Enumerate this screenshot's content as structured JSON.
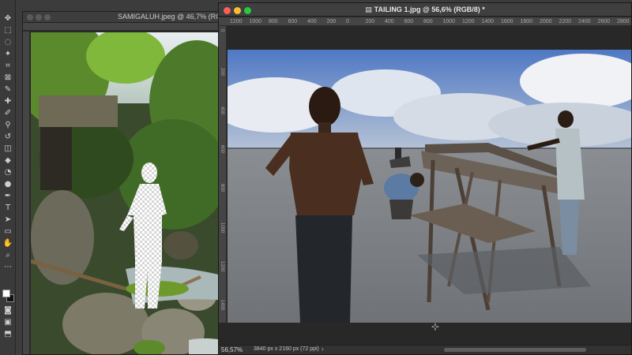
{
  "app": "Adobe Photoshop",
  "windows": [
    {
      "title": "SAMIGALUH.jpeg @ 46,7% (RG"
    },
    {
      "title": "TAILING 1.jpg @ 56,6% (RGB/8) *",
      "ruler_ticks": [
        "1200",
        "1000",
        "800",
        "600",
        "400",
        "200",
        "0",
        "200",
        "400",
        "600",
        "800",
        "1000",
        "1200",
        "1400",
        "1600",
        "1800",
        "2000",
        "2200",
        "2400",
        "2600",
        "2800"
      ],
      "left_ruler_ticks": [
        "0",
        "200",
        "400",
        "600",
        "800",
        "1000",
        "1200",
        "1400"
      ],
      "status": {
        "zoom": "56,57%",
        "doc_info": "3840 px x 2160 px (72 ppi)",
        "arrow": "›"
      }
    }
  ],
  "tools": [
    {
      "name": "move-tool-icon",
      "glyph": "✥"
    },
    {
      "name": "marquee-tool-icon",
      "glyph": "⬚"
    },
    {
      "name": "lasso-tool-icon",
      "glyph": "◌"
    },
    {
      "name": "magic-wand-tool-icon",
      "glyph": "✦"
    },
    {
      "name": "crop-tool-icon",
      "glyph": "⌗"
    },
    {
      "name": "frame-tool-icon",
      "glyph": "⊠"
    },
    {
      "name": "eyedropper-tool-icon",
      "glyph": "✎"
    },
    {
      "name": "healing-brush-tool-icon",
      "glyph": "✚"
    },
    {
      "name": "brush-tool-icon",
      "glyph": "✐"
    },
    {
      "name": "clone-stamp-tool-icon",
      "glyph": "⚲"
    },
    {
      "name": "history-brush-tool-icon",
      "glyph": "↺"
    },
    {
      "name": "eraser-tool-icon",
      "glyph": "◫"
    },
    {
      "name": "paint-bucket-tool-icon",
      "glyph": "◆"
    },
    {
      "name": "blur-tool-icon",
      "glyph": "◔"
    },
    {
      "name": "dodge-tool-icon",
      "glyph": "●"
    },
    {
      "name": "pen-tool-icon",
      "glyph": "✒"
    },
    {
      "name": "type-tool-icon",
      "glyph": "T"
    },
    {
      "name": "path-selection-tool-icon",
      "glyph": "➤"
    },
    {
      "name": "rectangle-tool-icon",
      "glyph": "▭"
    },
    {
      "name": "hand-tool-icon",
      "glyph": "✋"
    },
    {
      "name": "zoom-tool-icon",
      "glyph": "⌕"
    },
    {
      "name": "more-tools-icon",
      "glyph": "⋯"
    }
  ],
  "bottom_tools": [
    {
      "name": "quick-mask-icon",
      "glyph": "◙"
    },
    {
      "name": "screen-mode-icon",
      "glyph": "▣"
    },
    {
      "name": "edit-toolbar-icon",
      "glyph": "⬒"
    }
  ],
  "colors": {
    "foreground": "#ffffff",
    "background": "#111111"
  }
}
